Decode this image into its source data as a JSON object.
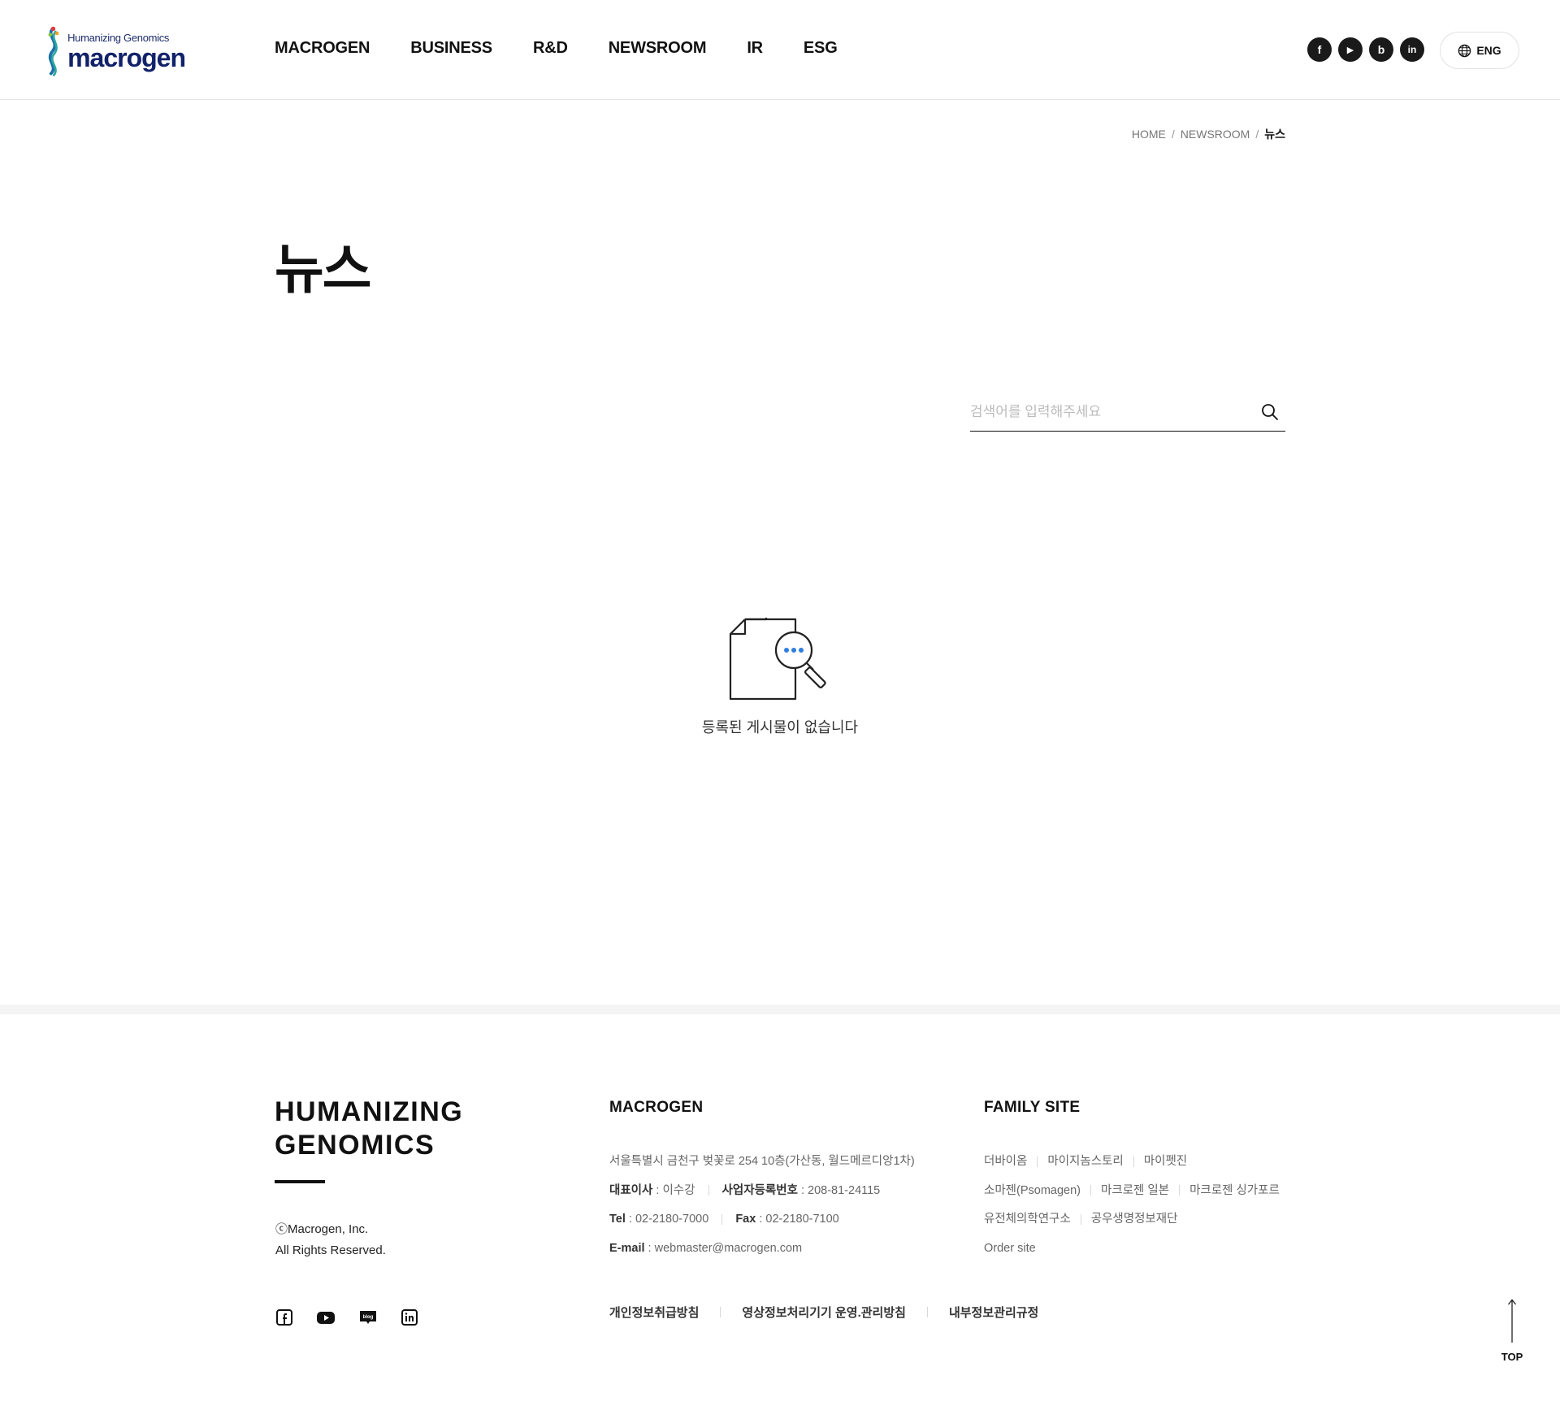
{
  "header": {
    "logo_tagline": "Humanizing Genomics",
    "logo_wordmark": "macrogen",
    "nav": [
      "MACROGEN",
      "BUSINESS",
      "R&D",
      "NEWSROOM",
      "IR",
      "ESG"
    ],
    "sns": [
      {
        "icon": "facebook-icon",
        "glyph": "f"
      },
      {
        "icon": "youtube-icon",
        "glyph": "▶"
      },
      {
        "icon": "blog-icon",
        "glyph": "b"
      },
      {
        "icon": "linkedin-icon",
        "glyph": "in"
      }
    ],
    "language": "ENG"
  },
  "breadcrumb": {
    "items": [
      "HOME",
      "NEWSROOM"
    ],
    "separator": "/",
    "current": "뉴스"
  },
  "page": {
    "title": "뉴스"
  },
  "search": {
    "placeholder": "검색어를 입력해주세요",
    "value": ""
  },
  "empty_state": {
    "message": "등록된 게시물이 없습니다"
  },
  "footer": {
    "slogan_line1": "HUMANIZING",
    "slogan_line2": "GENOMICS",
    "copyright_line1": "ⓒMacrogen, Inc.",
    "copyright_line2": "All Rights Reserved.",
    "company": {
      "title": "MACROGEN",
      "address": "서울특별시 금천구 벚꽃로 254 10층(가산동, 월드메르디앙1차)",
      "ceo_label": "대표이사",
      "ceo_value": ": 이수강",
      "reg_label": "사업자등록번호",
      "reg_value": ": 208-81-24115",
      "tel_label": "Tel",
      "tel_value": ": 02-2180-7000",
      "fax_label": "Fax",
      "fax_value": ": 02-2180-7100",
      "email_label": "E-mail",
      "email_value": ": webmaster@macrogen.com"
    },
    "family": {
      "title": "FAMILY SITE",
      "row1": [
        "더바이옴",
        "마이지놈스토리",
        "마이펫진"
      ],
      "row2": [
        "소마젠(Psomagen)",
        "마크로젠 일본",
        "마크로젠 싱가포르"
      ],
      "row3": [
        "유전체의학연구소",
        "공우생명정보재단"
      ],
      "row4": [
        "Order site"
      ]
    },
    "policies": [
      "개인정보취급방침",
      "영상정보처리기기 운영.관리방침",
      "내부정보관리규정"
    ],
    "top_label": "TOP"
  },
  "colors": {
    "accent": "#2f7de1",
    "logo_navy": "#12226a",
    "footer_band": "#f4f4f4"
  }
}
